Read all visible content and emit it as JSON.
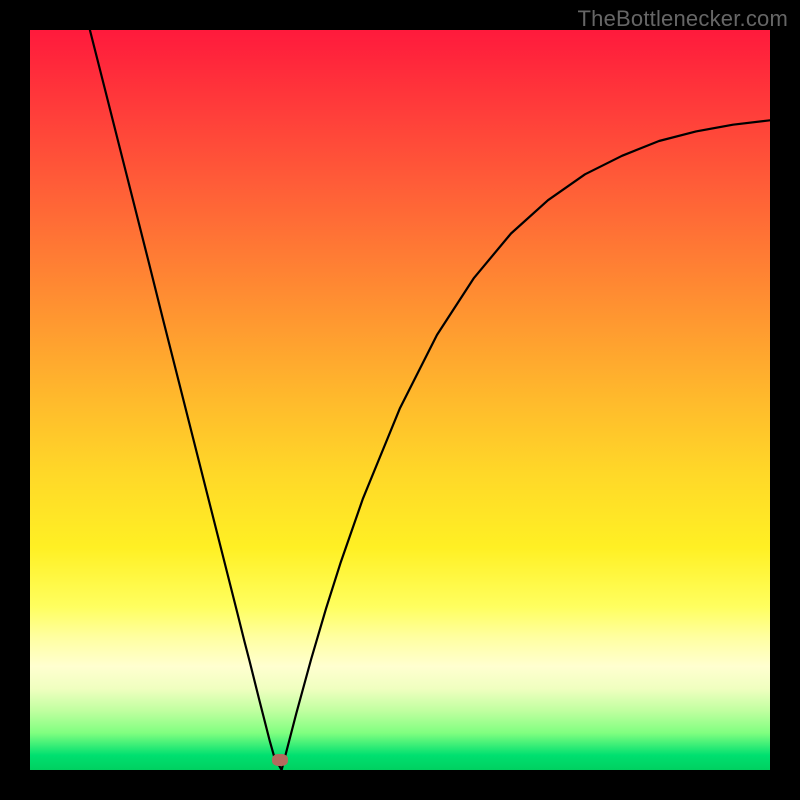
{
  "watermark": "TheBottlenecker.com",
  "chart_data": {
    "type": "line",
    "title": "",
    "xlabel": "",
    "ylabel": "",
    "xlim": [
      0,
      100
    ],
    "ylim": [
      0,
      100
    ],
    "x": [
      8.1,
      10,
      12,
      14,
      16,
      18,
      20,
      22,
      24,
      26,
      28,
      29,
      29.7,
      31,
      32.4,
      33,
      34,
      36,
      38,
      40,
      42,
      45,
      50,
      55,
      60,
      65,
      70,
      75,
      80,
      85,
      90,
      95,
      100
    ],
    "values": [
      100,
      92.5,
      84.6,
      76.7,
      68.8,
      60.8,
      52.9,
      45.0,
      37.1,
      29.2,
      21.3,
      17.3,
      14.6,
      9.4,
      3.9,
      1.8,
      0.0,
      7.7,
      15.0,
      21.8,
      28.1,
      36.7,
      48.9,
      58.8,
      66.5,
      72.5,
      77.0,
      80.5,
      83.0,
      85.0,
      86.3,
      87.2,
      87.8
    ],
    "marker": {
      "x": 33.8,
      "y": 1.4
    },
    "gradient_stops": [
      {
        "pos": 0.0,
        "color": "#ff1a3c"
      },
      {
        "pos": 0.5,
        "color": "#ffba2c"
      },
      {
        "pos": 0.82,
        "color": "#ffffa0"
      },
      {
        "pos": 0.95,
        "color": "#80ff80"
      },
      {
        "pos": 1.0,
        "color": "#00d060"
      }
    ]
  }
}
